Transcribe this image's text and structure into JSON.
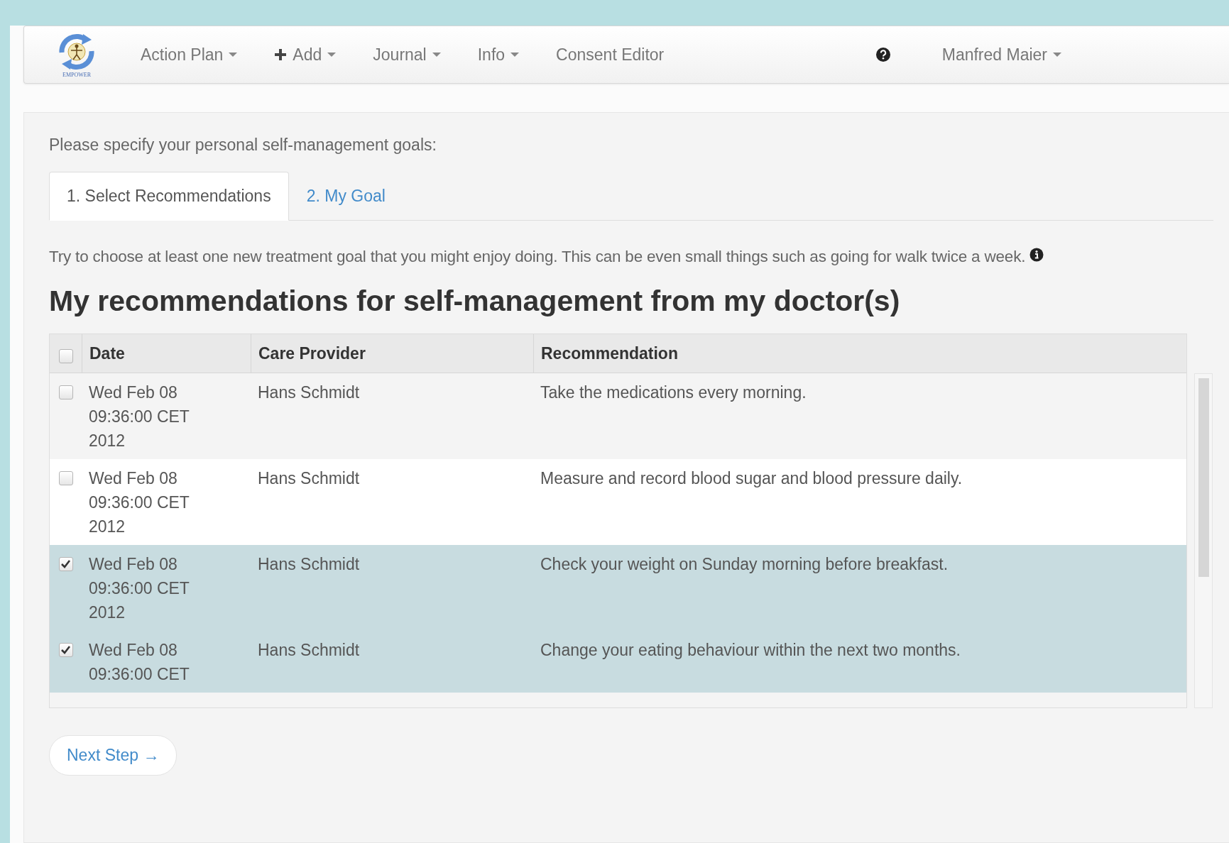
{
  "navbar": {
    "logo_text": "EMPOWER",
    "menus": [
      {
        "label": "Action Plan",
        "kind": "dropdown"
      },
      {
        "label": "Add",
        "kind": "add"
      },
      {
        "label": "Journal",
        "kind": "dropdown"
      },
      {
        "label": "Info",
        "kind": "dropdown"
      },
      {
        "label": "Consent Editor",
        "kind": "link"
      }
    ],
    "user": "Manfred Maier"
  },
  "intro": "Please specify your personal self-management goals:",
  "tabs": [
    {
      "label": "1. Select Recommendations",
      "selected": true
    },
    {
      "label": "2. My Goal",
      "selected": false
    }
  ],
  "hint": "Try to choose at least one new treatment goal that you might enjoy doing. This can be even small things such as going for walk twice a week.",
  "heading": "My recommendations for self-management from my doctor(s)",
  "table": {
    "all_checked": false,
    "columns": [
      "Date",
      "Care Provider",
      "Recommendation"
    ],
    "rows": [
      {
        "checked": false,
        "date": "Wed Feb 08 09:36:00 CET 2012",
        "provider": "Hans Schmidt",
        "recommendation": "Take the medications every morning."
      },
      {
        "checked": false,
        "date": "Wed Feb 08 09:36:00 CET 2012",
        "provider": "Hans Schmidt",
        "recommendation": "Measure and record blood sugar and blood pressure daily."
      },
      {
        "checked": true,
        "date": "Wed Feb 08 09:36:00 CET 2012",
        "provider": "Hans Schmidt",
        "recommendation": "Check your weight on Sunday morning before breakfast."
      },
      {
        "checked": true,
        "date": "Wed Feb 08 09:36:00 CET",
        "provider": "Hans Schmidt",
        "recommendation": "Change your eating behaviour within the next two months."
      }
    ]
  },
  "next_button": "Next Step →"
}
